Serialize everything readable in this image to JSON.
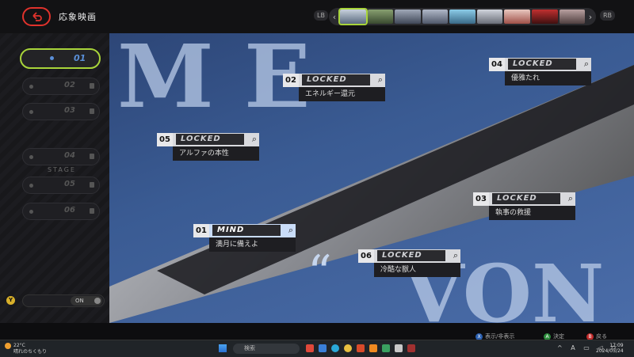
{
  "app": {
    "title": "応象映画"
  },
  "topbar": {
    "lb": "LB",
    "rb": "RB",
    "prev": "‹",
    "next": "›"
  },
  "sidebar": {
    "episodes": [
      {
        "num": "01",
        "active": true
      },
      {
        "num": "02",
        "active": false
      },
      {
        "num": "03",
        "active": false
      },
      {
        "num": "04",
        "active": false
      },
      {
        "num": "05",
        "active": false
      },
      {
        "num": "06",
        "active": false
      }
    ],
    "stage_label": "STAGE",
    "y_button": "Y",
    "toggle_state": "ON"
  },
  "chapters": [
    {
      "num": "01",
      "tag": "MIND",
      "subtitle": "満月に備えよ",
      "active": true
    },
    {
      "num": "02",
      "tag": "LOCKED",
      "subtitle": "エネルギー還元",
      "active": false
    },
    {
      "num": "03",
      "tag": "LOCKED",
      "subtitle": "執事の救援",
      "active": false
    },
    {
      "num": "04",
      "tag": "LOCKED",
      "subtitle": "優雅たれ",
      "active": false
    },
    {
      "num": "05",
      "tag": "LOCKED",
      "subtitle": "アルファの本性",
      "active": false
    },
    {
      "num": "06",
      "tag": "LOCKED",
      "subtitle": "冷酷な獣人",
      "active": false
    }
  ],
  "background": {
    "letters_top": "M E",
    "letters_bottom": "VON",
    "quote": "“"
  },
  "hints": {
    "x_key": "X",
    "x_label": "表示/非表示",
    "a_key": "A",
    "a_label": "決定",
    "b_key": "B",
    "b_label": "戻る"
  },
  "taskbar": {
    "weather_temp": "22°C",
    "weather_desc": "晴れのちくもり",
    "search_placeholder": "検索",
    "time": "17:09",
    "date": "2024/05/24"
  },
  "colors": {
    "accent": "#a8d43a",
    "back": "#e0322c",
    "active_blue": "#5a8fd8"
  }
}
